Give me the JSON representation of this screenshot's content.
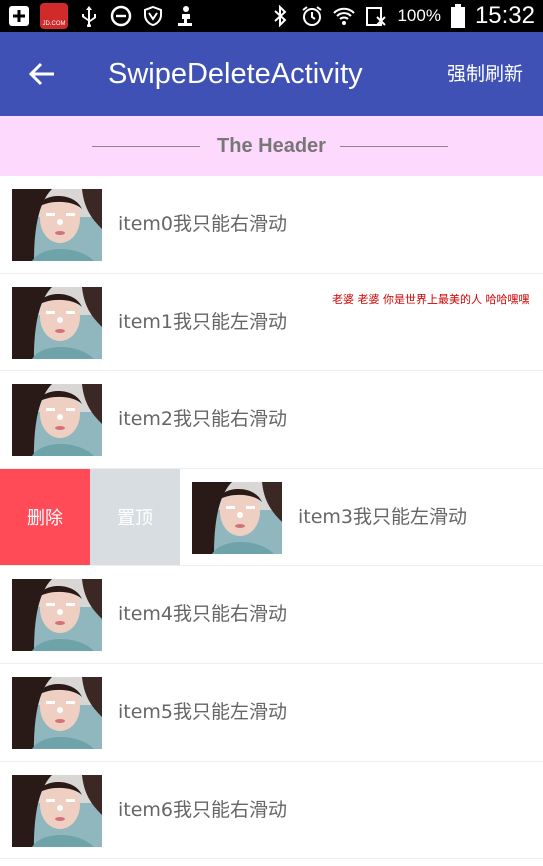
{
  "status_bar": {
    "battery_percent": "100%",
    "time": "15:32",
    "notification_app_label": "JD.COM"
  },
  "app_bar": {
    "title": "SwipeDeleteActivity",
    "action_label": "强制刷新"
  },
  "header": {
    "title": "The Header"
  },
  "list": {
    "items": [
      {
        "label": "item0我只能右滑动"
      },
      {
        "label": "item1我只能左滑动",
        "note": "老婆 老婆 你是世界上最美的人 哈哈嘿嘿"
      },
      {
        "label": "item2我只能右滑动"
      },
      {
        "label": "item3我只能左滑动",
        "actions": {
          "delete": "删除",
          "top": "置顶"
        }
      },
      {
        "label": "item4我只能右滑动"
      },
      {
        "label": "item5我只能左滑动"
      },
      {
        "label": "item6我只能右滑动"
      }
    ]
  },
  "colors": {
    "app_bar": "#3f51b5",
    "header_bg": "#fdd9fd",
    "delete_bg": "#ff4a57",
    "top_bg": "#d8dde2",
    "note_text": "#d00000"
  }
}
